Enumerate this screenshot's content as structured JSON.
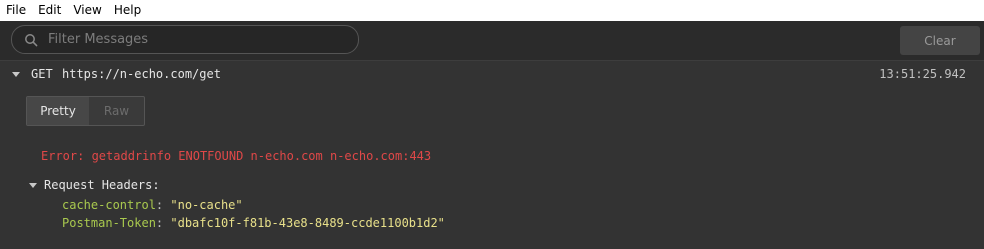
{
  "menu": {
    "items": [
      "File",
      "Edit",
      "View",
      "Help"
    ]
  },
  "toolbar": {
    "filter_placeholder": "Filter Messages",
    "filter_value": "",
    "clear_label": "Clear"
  },
  "request": {
    "method": "GET",
    "url": "https://n-echo.com/get",
    "time": "13:51:25.942"
  },
  "view_tabs": {
    "pretty": "Pretty",
    "raw": "Raw",
    "active": "Pretty"
  },
  "error_text": "Error: getaddrinfo ENOTFOUND n-echo.com n-echo.com:443",
  "request_headers": {
    "title": "Request Headers:",
    "rows": [
      {
        "key": "cache-control",
        "value": "\"no-cache\""
      },
      {
        "key": "Postman-Token",
        "value": "\"dbafc10f-f81b-43e8-8489-ccde1100b1d2\""
      }
    ]
  },
  "colors": {
    "background": "#333333",
    "error": "#e04848",
    "header_key": "#a9c94e",
    "header_value": "#e8e08a"
  },
  "icons": {
    "filter": "search-icon",
    "expand": "caret-down-icon"
  }
}
